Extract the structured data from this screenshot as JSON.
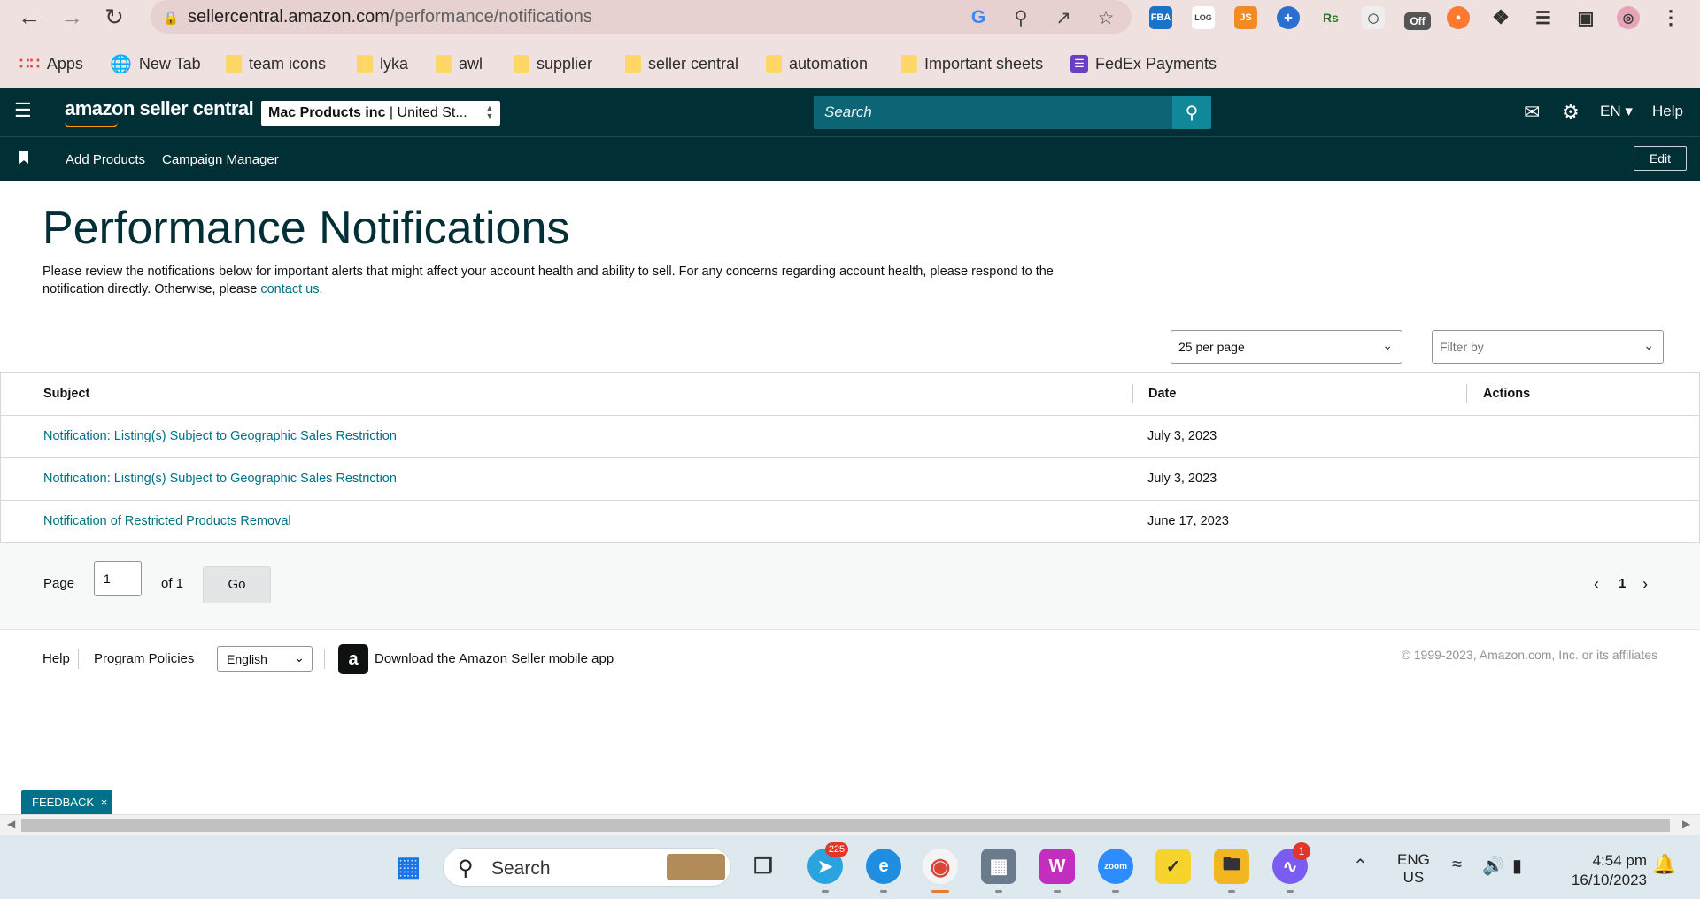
{
  "browser": {
    "url_host": "sellercentral.amazon.com",
    "url_path": "/performance/notifications",
    "bookmarks": [
      {
        "label": "Apps"
      },
      {
        "label": "New Tab"
      },
      {
        "label": "team icons"
      },
      {
        "label": "lyka"
      },
      {
        "label": "awl"
      },
      {
        "label": "supplier"
      },
      {
        "label": "seller central"
      },
      {
        "label": "automation"
      },
      {
        "label": "Important sheets"
      },
      {
        "label": "FedEx Payments"
      }
    ],
    "extension_badge": "Off"
  },
  "header": {
    "logo_text": "amazon seller central",
    "account_name": "Mac Products inc",
    "account_region": "United St...",
    "search_placeholder": "Search",
    "language": "EN",
    "help": "Help",
    "subnav": {
      "items": [
        "Add Products",
        "Campaign Manager"
      ],
      "edit": "Edit"
    }
  },
  "main": {
    "title": "Performance Notifications",
    "description": "Please review the notifications below for important alerts that might affect your account health and ability to sell. For any concerns regarding account health, please respond to the notification directly. Otherwise, please",
    "contact_link": "contact us.",
    "per_page": "25 per page",
    "filter_placeholder": "Filter by",
    "table": {
      "headers": {
        "subject": "Subject",
        "date": "Date",
        "actions": "Actions"
      },
      "rows": [
        {
          "subject": "Notification: Listing(s) Subject to Geographic Sales Restriction",
          "date": "July 3, 2023"
        },
        {
          "subject": "Notification: Listing(s) Subject to Geographic Sales Restriction",
          "date": "July 3, 2023"
        },
        {
          "subject": "Notification of Restricted Products Removal",
          "date": "June 17, 2023"
        }
      ]
    },
    "pagination": {
      "page_label": "Page",
      "current_page": "1",
      "of_label": "of 1",
      "go": "Go",
      "page_number": "1"
    }
  },
  "footer": {
    "help": "Help",
    "program_policies": "Program Policies",
    "language": "English",
    "app_link": "Download the Amazon Seller mobile app",
    "copyright": "© 1999-2023, Amazon.com, Inc. or its affiliates",
    "feedback": "FEEDBACK"
  },
  "taskbar": {
    "search": "Search",
    "telegram_badge": "225",
    "messenger_badge": "1",
    "lang_line1": "ENG",
    "lang_line2": "US",
    "time": "4:54 pm",
    "date": "16/10/2023"
  },
  "colors": {
    "header_bg": "#002f36",
    "link": "#007185",
    "search_bg": "#0b6574",
    "feedback_bg": "#00708b"
  }
}
